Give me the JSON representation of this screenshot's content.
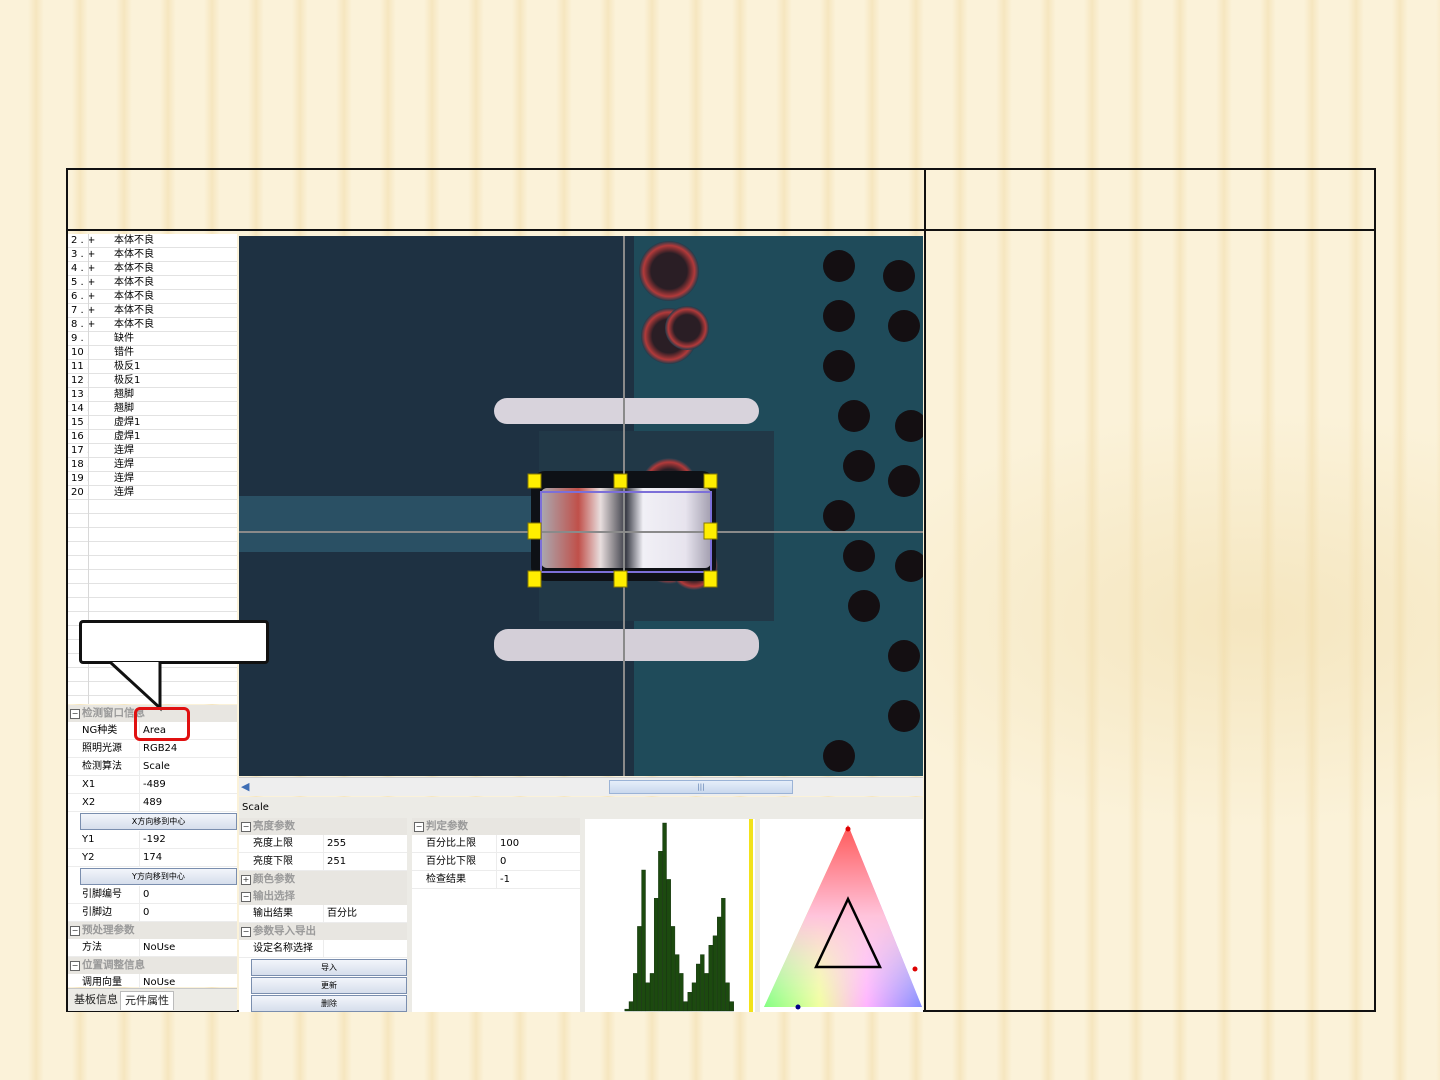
{
  "left_list": [
    {
      "num": "2 .",
      "mark": "+",
      "label": "本体不良"
    },
    {
      "num": "3 .",
      "mark": "+",
      "label": "本体不良"
    },
    {
      "num": "4 .",
      "mark": "+",
      "label": "本体不良"
    },
    {
      "num": "5 .",
      "mark": "+",
      "label": "本体不良"
    },
    {
      "num": "6 .",
      "mark": "+",
      "label": "本体不良"
    },
    {
      "num": "7 .",
      "mark": "+",
      "label": "本体不良"
    },
    {
      "num": "8 .",
      "mark": "+",
      "label": "本体不良"
    },
    {
      "num": "9 .",
      "mark": "",
      "label": "缺件"
    },
    {
      "num": "10 .",
      "mark": "",
      "label": "错件"
    },
    {
      "num": "11 .",
      "mark": "",
      "label": "极反1"
    },
    {
      "num": "12 .",
      "mark": "",
      "label": "极反1"
    },
    {
      "num": "13 .",
      "mark": "",
      "label": "翘脚"
    },
    {
      "num": "14 .",
      "mark": "",
      "label": "翘脚"
    },
    {
      "num": "15 .",
      "mark": "",
      "label": "虚焊1"
    },
    {
      "num": "16 .",
      "mark": "",
      "label": "虚焊1"
    },
    {
      "num": "17 .",
      "mark": "",
      "label": "连焊"
    },
    {
      "num": "18 .",
      "mark": "",
      "label": "连焊"
    },
    {
      "num": "19 .",
      "mark": "",
      "label": "连焊"
    },
    {
      "num": "20 .",
      "mark": "",
      "label": "连焊"
    }
  ],
  "window_info": {
    "category": "检测窗口信息",
    "rows": [
      {
        "k": "NG种类",
        "v": "Area"
      },
      {
        "k": "照明光源",
        "v": "RGB24"
      },
      {
        "k": "检测算法",
        "v": "Scale"
      },
      {
        "k": "X1",
        "v": "-489"
      },
      {
        "k": "X2",
        "v": "489"
      }
    ],
    "x_center_btn": "X方向移到中心",
    "rows2": [
      {
        "k": "Y1",
        "v": "-192"
      },
      {
        "k": "Y2",
        "v": "174"
      }
    ],
    "y_center_btn": "Y方向移到中心",
    "rows3": [
      {
        "k": "引脚编号",
        "v": "0"
      },
      {
        "k": "引脚边",
        "v": "0"
      }
    ],
    "preprocess_cat": "预处理参数",
    "preprocess_row": {
      "k": "方法",
      "v": "NoUse"
    },
    "position_cat": "位置调整信息",
    "position_row": {
      "k": "调用向量",
      "v": "NoUse"
    }
  },
  "tabs": {
    "board": "基板信息",
    "component": "元件属性"
  },
  "algo_name": "Scale",
  "params_left": {
    "brightness_cat": "亮度参数",
    "rows": [
      {
        "k": "亮度上限",
        "v": "255"
      },
      {
        "k": "亮度下限",
        "v": "251"
      }
    ],
    "color_cat": "颜色参数",
    "output_cat": "输出选择",
    "output_row": {
      "k": "输出结果",
      "v": "百分比"
    },
    "io_cat": "参数导入导出",
    "name_row": {
      "k": "设定名称选择",
      "v": ""
    },
    "import_btn": "导入",
    "update_btn": "更新",
    "delete_btn": "删除"
  },
  "params_right": {
    "judge_cat": "判定参数",
    "rows": [
      {
        "k": "百分比上限",
        "v": "100"
      },
      {
        "k": "百分比下限",
        "v": "0"
      },
      {
        "k": "检查结果",
        "v": "-1"
      }
    ]
  },
  "scroll_thumb": "|||",
  "histogram": {
    "values": [
      0,
      0,
      0,
      0,
      0,
      0,
      0,
      0,
      0,
      2,
      10,
      40,
      90,
      150,
      30,
      40,
      120,
      170,
      200,
      140,
      90,
      60,
      40,
      10,
      20,
      30,
      50,
      60,
      40,
      70,
      80,
      100,
      120,
      30,
      10,
      0,
      0,
      0
    ],
    "colors": {
      "bar": "#1c4a0f",
      "marker": "#f2e21a"
    }
  },
  "colors": {
    "callout_border": "#111111",
    "highlight": "#e01010",
    "handle": "#ffee00",
    "roi": "#7c6fd8"
  }
}
